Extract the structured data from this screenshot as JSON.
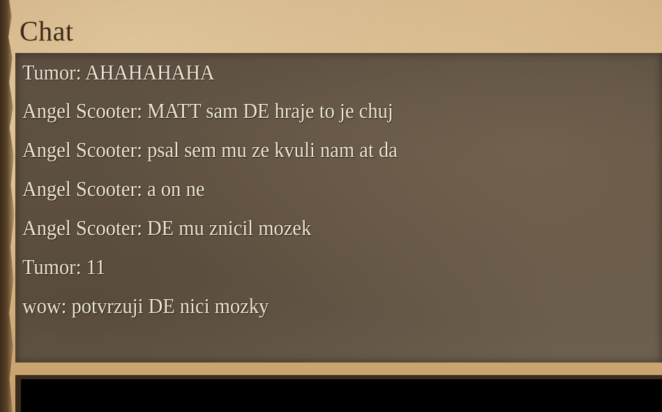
{
  "chat": {
    "title": "Chat",
    "messages": [
      "Tumor: AHAHAHAHA",
      "Angel Scooter: MATT sam DE hraje to je chuj",
      "Angel Scooter: psal sem mu ze kvuli nam at da",
      "Angel Scooter: a on ne",
      "Angel Scooter: DE mu znicil mozek",
      "Tumor: 11",
      "wow: potvrzuji DE nici mozky"
    ],
    "input": {
      "value": ""
    }
  }
}
